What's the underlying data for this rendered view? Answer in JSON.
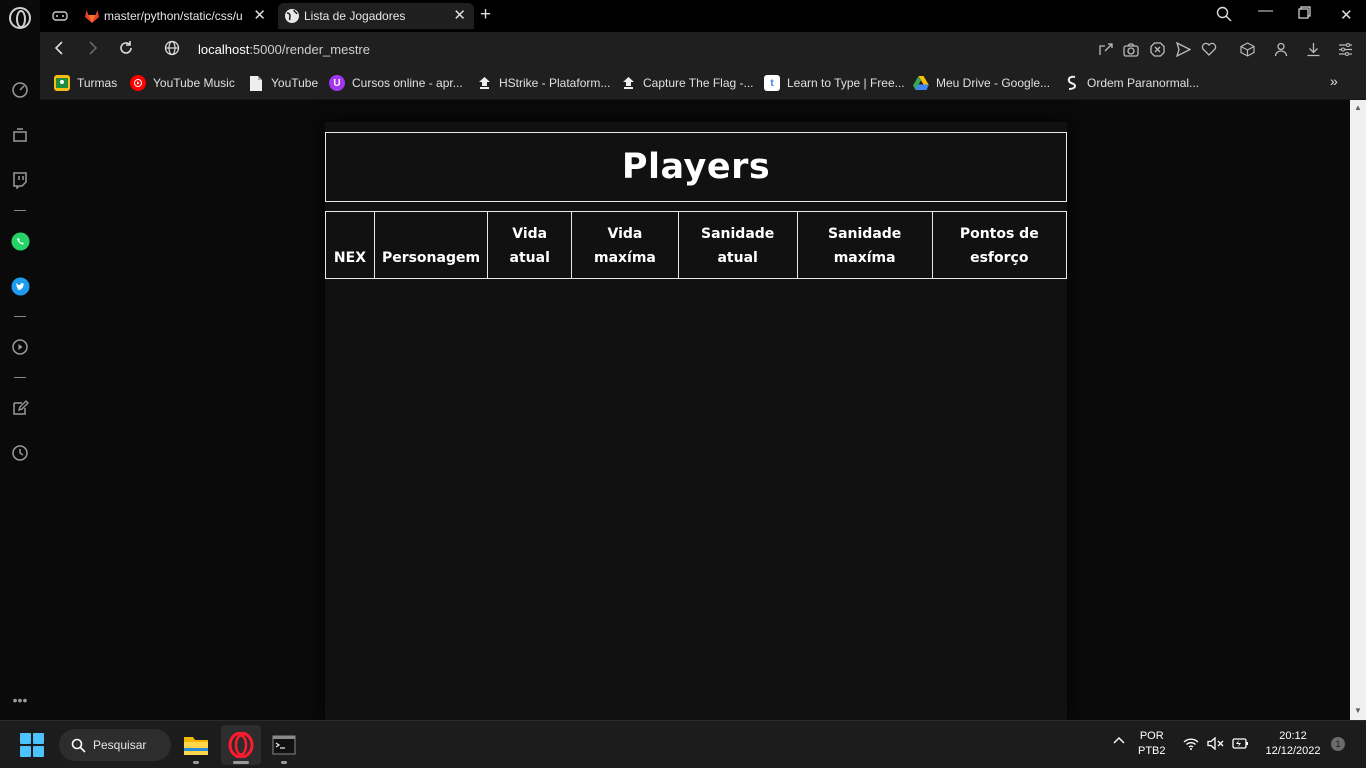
{
  "browser": {
    "tabs": [
      {
        "title": "master/python/static/css/u",
        "active": false
      },
      {
        "title": "Lista de Jogadores",
        "active": true
      }
    ],
    "address": {
      "host": "localhost",
      "path": ":5000/render_mestre"
    },
    "bookmarks": [
      {
        "label": "Turmas",
        "icon": "google-classroom-icon",
        "color": "#f9bc15"
      },
      {
        "label": "YouTube Music",
        "icon": "youtube-music-icon",
        "color": "#ff0000"
      },
      {
        "label": "YouTube",
        "icon": "page-icon",
        "color": "#ffffff"
      },
      {
        "label": "Cursos online - apr...",
        "icon": "udemy-icon",
        "color": "#a435f0"
      },
      {
        "label": "HStrike - Plataform...",
        "icon": "hstrike-icon",
        "color": "#ffffff"
      },
      {
        "label": "Capture The Flag -...",
        "icon": "ctf-icon",
        "color": "#ffffff"
      },
      {
        "label": "Learn to Type | Free...",
        "icon": "typing-icon",
        "color": "#5aa0e6"
      },
      {
        "label": "Meu Drive - Google...",
        "icon": "google-drive-icon",
        "color": "#34a853"
      },
      {
        "label": "Ordem Paranormal...",
        "icon": "ordem-icon",
        "color": "#ffffff"
      }
    ]
  },
  "page": {
    "heading": "Players",
    "columns": [
      {
        "line1": "",
        "line2": "NEX"
      },
      {
        "line1": "",
        "line2": "Personagem"
      },
      {
        "line1": "Vida",
        "line2": "atual"
      },
      {
        "line1": "Vida",
        "line2": "maxíma"
      },
      {
        "line1": "Sanidade",
        "line2": "atual"
      },
      {
        "line1": "Sanidade",
        "line2": "maxíma"
      },
      {
        "line1": "Pontos de",
        "line2": "esforço"
      }
    ]
  },
  "taskbar": {
    "search_label": "Pesquisar",
    "language": "POR",
    "keyboard": "PTB2",
    "time": "20:12",
    "date": "12/12/2022",
    "notifications": "1"
  }
}
